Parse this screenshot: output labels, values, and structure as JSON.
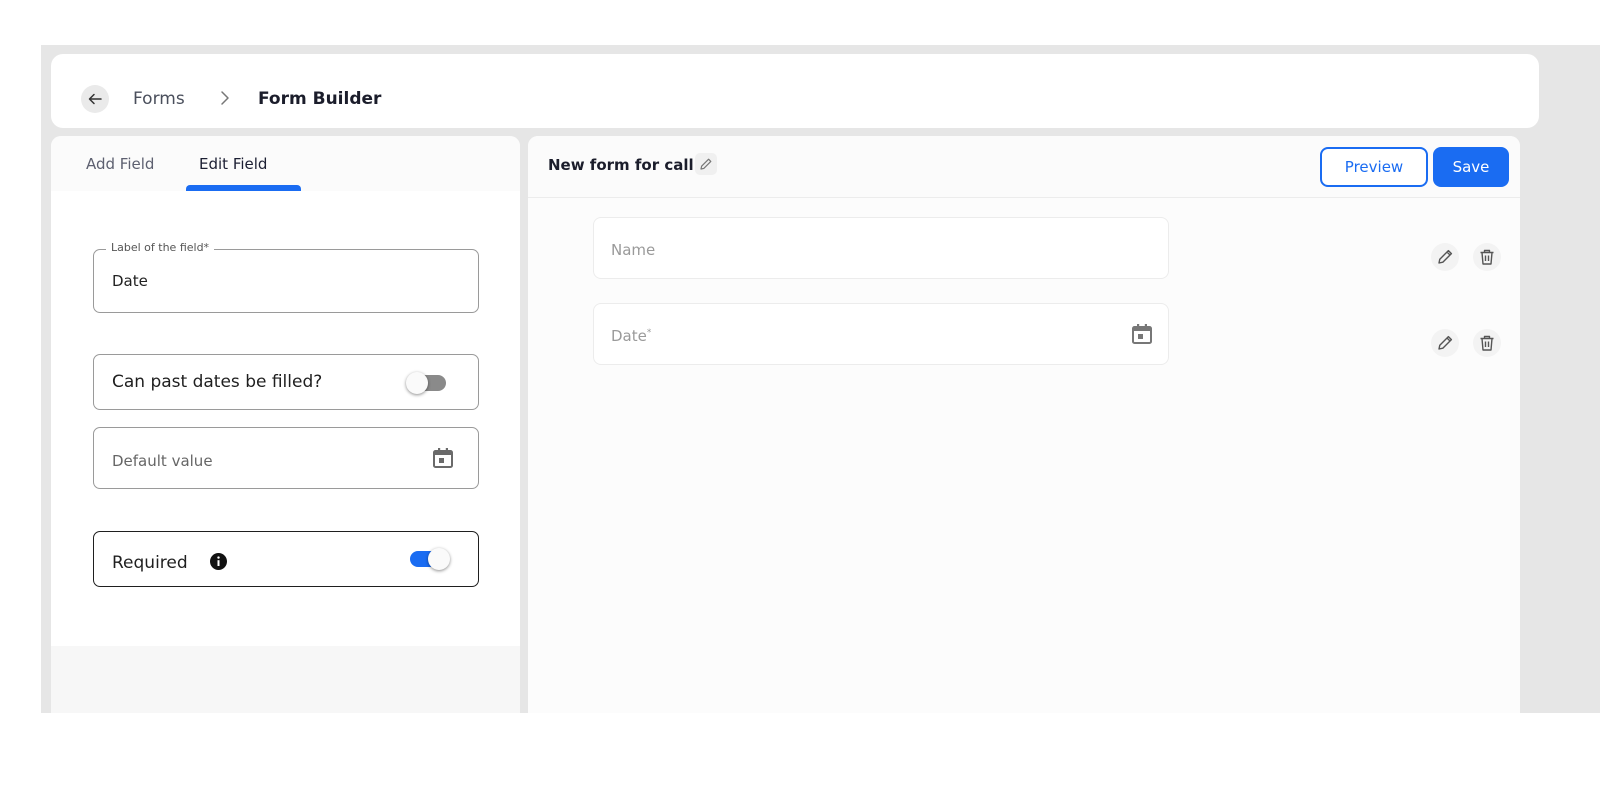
{
  "breadcrumb": {
    "back_icon": "arrow-left-icon",
    "parent": "Forms",
    "separator_icon": "chevron-right-icon",
    "current": "Form Builder"
  },
  "left_panel": {
    "tabs": [
      {
        "label": "Add Field",
        "active": false
      },
      {
        "label": "Edit Field",
        "active": true
      }
    ],
    "label_field": {
      "legend": "Label of the field*",
      "value": "Date"
    },
    "past_dates_toggle": {
      "label": "Can past dates be filled?",
      "on": false
    },
    "default_value": {
      "placeholder": "Default value",
      "icon": "calendar-icon"
    },
    "required_toggle": {
      "label": "Required",
      "info_icon": "info-icon",
      "on": true
    }
  },
  "right_panel": {
    "form_title": "New form for call",
    "title_edit_icon": "pencil-icon",
    "preview_label": "Preview",
    "save_label": "Save",
    "fields": [
      {
        "placeholder": "Name",
        "required_mark": "",
        "icon": ""
      },
      {
        "placeholder": "Date",
        "required_mark": "*",
        "icon": "calendar-icon"
      }
    ],
    "row_actions": [
      "pencil-icon",
      "trash-icon"
    ]
  },
  "colors": {
    "accent": "#1a6cf2",
    "page_background": "#e6e6e6",
    "text_dark": "#1b1d2b"
  }
}
